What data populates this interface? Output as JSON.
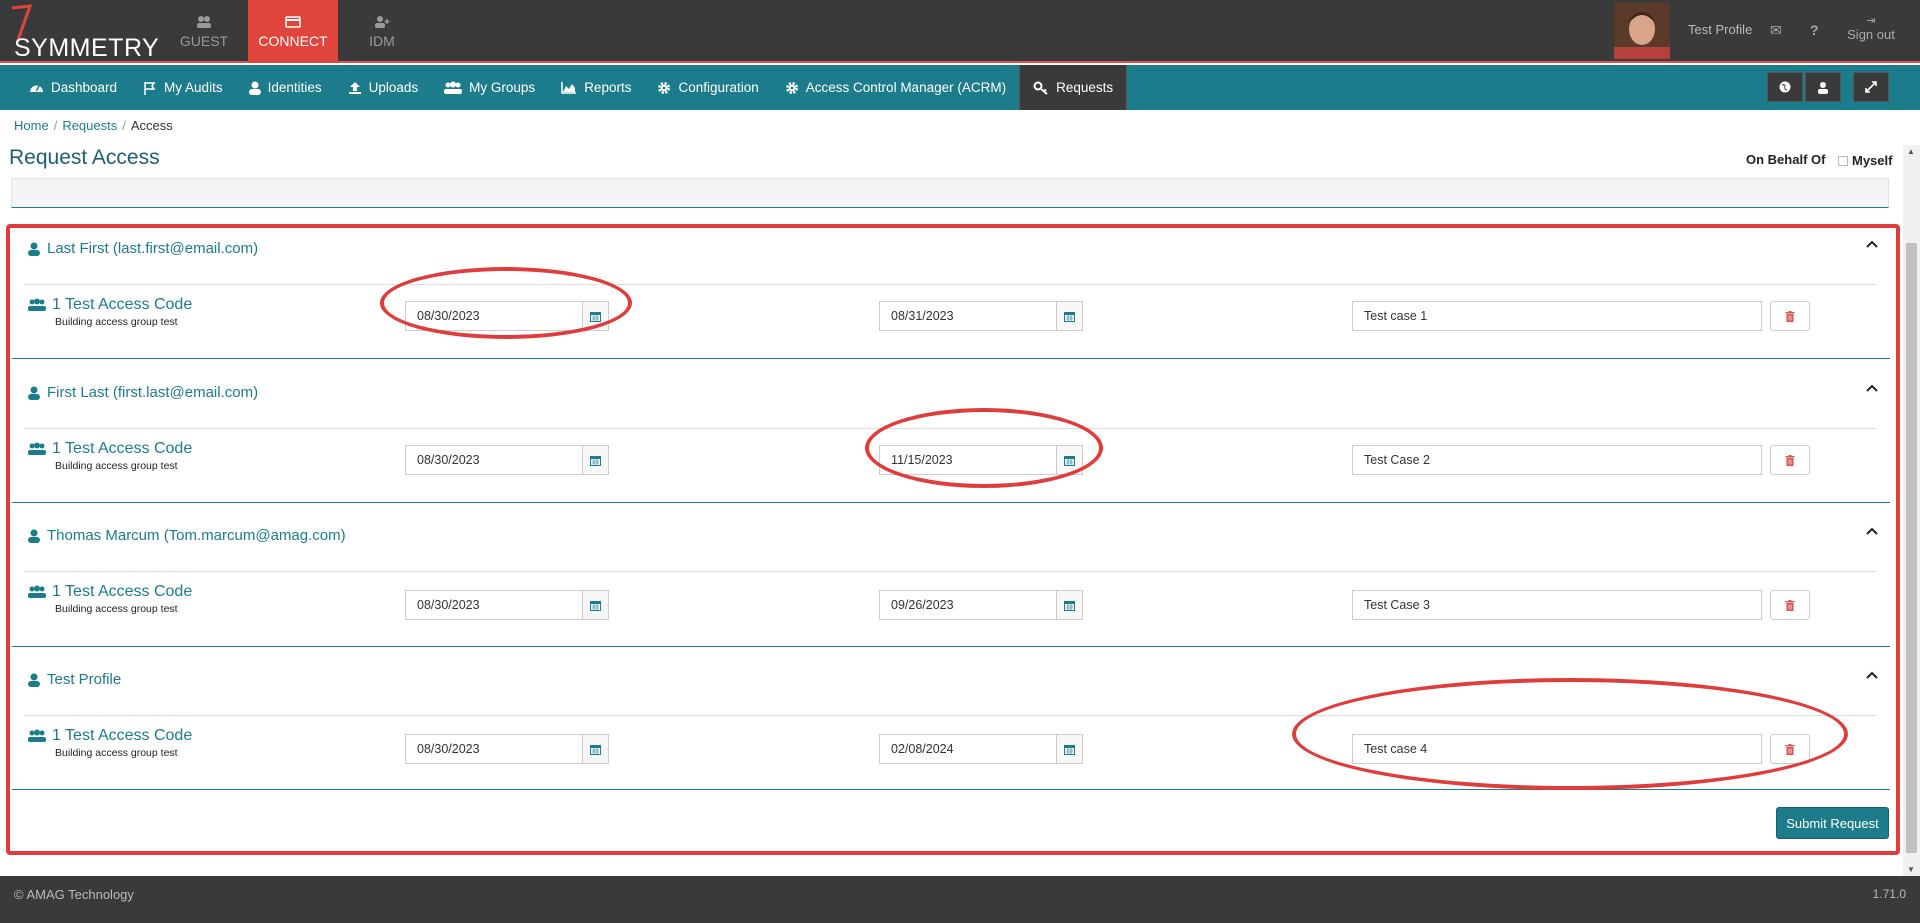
{
  "header": {
    "logo_text": "SYMMETRY",
    "topnav": [
      {
        "label": "GUEST",
        "icon": "users-icon"
      },
      {
        "label": "CONNECT",
        "icon": "card-icon"
      },
      {
        "label": "IDM",
        "icon": "user-plus-icon"
      }
    ],
    "profile_name": "Test Profile",
    "signout_label": "Sign out"
  },
  "mainnav": [
    {
      "label": "Dashboard",
      "icon": "dashboard-icon"
    },
    {
      "label": "My Audits",
      "icon": "flag-icon"
    },
    {
      "label": "Identities",
      "icon": "user-icon"
    },
    {
      "label": "Uploads",
      "icon": "upload-icon"
    },
    {
      "label": "My Groups",
      "icon": "group-icon"
    },
    {
      "label": "Reports",
      "icon": "area-chart-icon"
    },
    {
      "label": "Configuration",
      "icon": "gear-icon"
    },
    {
      "label": "Access Control Manager (ACRM)",
      "icon": "gear-icon"
    },
    {
      "label": "Requests",
      "icon": "key-icon"
    }
  ],
  "breadcrumb": {
    "home": "Home",
    "requests": "Requests",
    "current": "Access"
  },
  "page": {
    "title": "Request Access",
    "on_behalf_of": "On Behalf Of",
    "myself": "Myself"
  },
  "requests": [
    {
      "person": "Last First (last.first@email.com)",
      "access": "1 Test Access Code",
      "desc": "Building access group test",
      "start": "08/30/2023",
      "end": "08/31/2023",
      "note": "Test case 1"
    },
    {
      "person": "First Last (first.last@email.com)",
      "access": "1 Test Access Code",
      "desc": "Building access group test",
      "start": "08/30/2023",
      "end": "11/15/2023",
      "note": "Test Case 2"
    },
    {
      "person": "Thomas Marcum (Tom.marcum@amag.com)",
      "access": "1 Test Access Code",
      "desc": "Building access group test",
      "start": "08/30/2023",
      "end": "09/26/2023",
      "note": "Test Case 3"
    },
    {
      "person": "Test Profile",
      "access": "1 Test Access Code",
      "desc": "Building access group test",
      "start": "08/30/2023",
      "end": "02/08/2024",
      "note": "Test case 4"
    }
  ],
  "submit_label": "Submit Request",
  "footer": {
    "copyright": "© AMAG Technology",
    "version": "1.71.0"
  },
  "colors": {
    "accent": "#1c7c8c",
    "brand_red": "#e0453c",
    "annotation": "#e03c3c",
    "dark": "#3a3a3a"
  }
}
